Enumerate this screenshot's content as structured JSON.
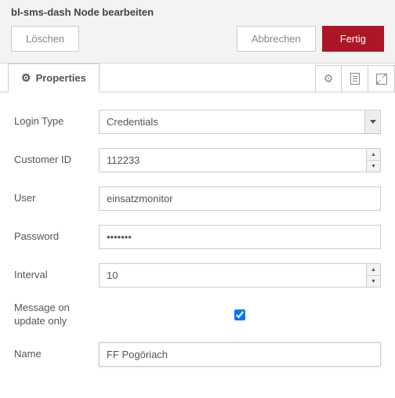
{
  "header": {
    "title": "bl-sms-dash Node bearbeiten",
    "delete_label": "Löschen",
    "cancel_label": "Abbrechen",
    "done_label": "Fertig"
  },
  "tabs": {
    "properties_label": "Properties"
  },
  "form": {
    "login_type": {
      "label": "Login Type",
      "value": "Credentials"
    },
    "customer_id": {
      "label": "Customer ID",
      "value": "112233"
    },
    "user": {
      "label": "User",
      "value": "einsatzmonitor"
    },
    "password": {
      "label": "Password",
      "value": "•••••••"
    },
    "interval": {
      "label": "Interval",
      "value": "10"
    },
    "message_update": {
      "label": "Message on update only",
      "checked": true
    },
    "name": {
      "label": "Name",
      "value": "FF Pogöriach"
    }
  }
}
